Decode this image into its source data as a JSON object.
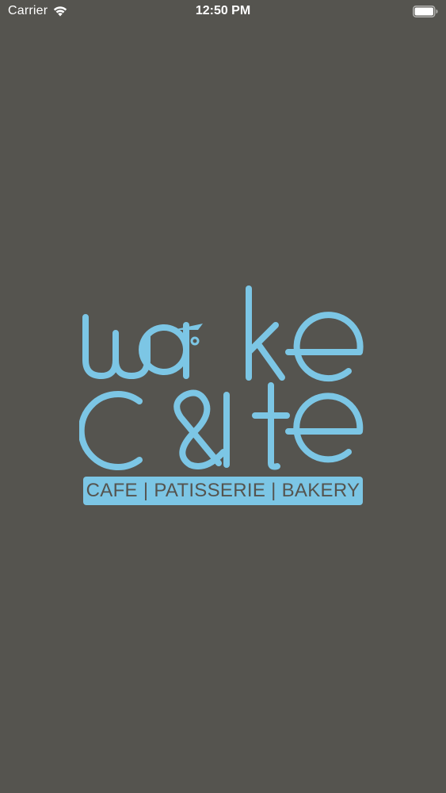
{
  "status_bar": {
    "carrier": "Carrier",
    "time": "12:50 PM",
    "wifi_icon": "wifi-icon",
    "battery_icon": "battery-full-icon"
  },
  "splash": {
    "logo_text": "wake cate",
    "tagline": "CAFE | PATISSERIE | BAKERY",
    "brand_color": "#7cc6e5",
    "background_color": "#55544f"
  }
}
